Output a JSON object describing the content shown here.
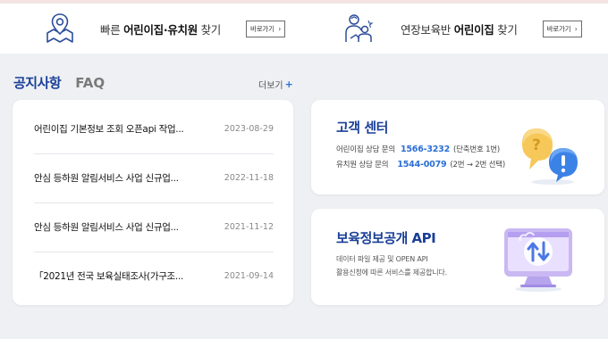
{
  "quick_links": [
    {
      "prefix": "빠른 ",
      "bold": "어린이집·유치원",
      "suffix": " 찾기",
      "button": "바로가기",
      "icon": "map-pin-icon"
    },
    {
      "prefix": "연장보육반 ",
      "bold": "어린이집",
      "suffix": " 찾기",
      "button": "바로가기",
      "icon": "caregiver-child-icon"
    }
  ],
  "notice": {
    "tabs": [
      "공지사항",
      "FAQ"
    ],
    "more_label": "더보기",
    "more_plus": "+",
    "items": [
      {
        "title": "어린이집 기본정보 조회 오픈api 작업...",
        "date": "2023-08-29"
      },
      {
        "title": "안심 등하원 알림서비스 사업 신규업...",
        "date": "2022-11-18"
      },
      {
        "title": "안심 등하원 알림서비스 사업 신규업...",
        "date": "2021-11-12"
      },
      {
        "title": "「2021년 전국 보육실태조사(가구조...",
        "date": "2021-09-14"
      }
    ]
  },
  "customer_center": {
    "title": "고객 센터",
    "lines": [
      {
        "label": "어린이집 상담 문의",
        "number": "1566-3232",
        "note": "(단축번호 1번)"
      },
      {
        "label": "유치원 상담 문의",
        "number": "1544-0079",
        "note": "(2번 → 2번 선택)"
      }
    ],
    "icon": "question-exclamation-bubbles-icon"
  },
  "api_card": {
    "title": "보육정보공개 API",
    "lines": [
      "데이터 파일 제공 및 OPEN API",
      "활용신청에 따른 서비스를 제공합니다."
    ],
    "icon": "monitor-data-transfer-icon"
  },
  "colors": {
    "accent": "#1a3f97",
    "link_blue": "#2b6fd6",
    "background": "#eef0f3"
  }
}
